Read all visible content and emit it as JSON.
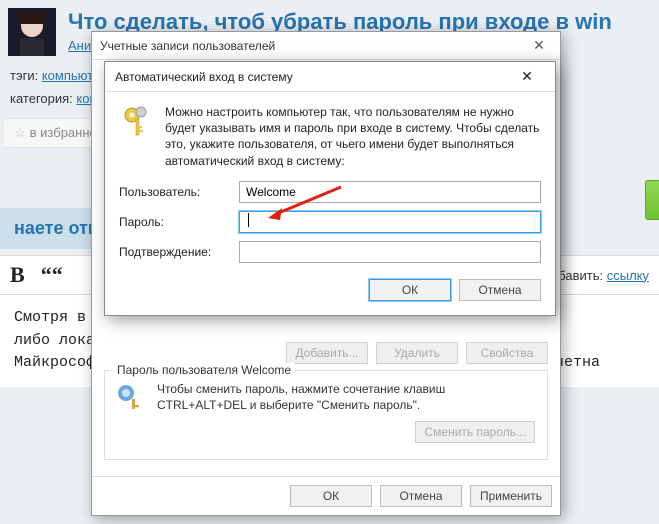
{
  "page": {
    "title": "Что сделать, чтоб убрать пароль при входе в win",
    "author_link": "Аникс [",
    "tags_label": "тэги:",
    "tags_link": "компьютер,",
    "category_label": "категория:",
    "category_link": "компь",
    "favorite": "в избранное",
    "answer_tab": "наете ответ",
    "add_label": "добавить:",
    "add_link": "ссылку",
    "answer_text": "Смотря в ка\nлибо локаль\nМайкрософт",
    "answer_suffix": "ановке? Учетна"
  },
  "parent_dialog": {
    "title": "Учетные записи пользователей",
    "add_btn": "Добавить...",
    "remove_btn": "Удалить",
    "props_btn": "Свойства",
    "group_legend": "Пароль пользователя Welcome",
    "group_help": "Чтобы сменить пароль, нажмите сочетание клавиш CTRL+ALT+DEL и выберите \"Сменить пароль\".",
    "change_pw_btn": "Сменить пароль...",
    "ok": "ОК",
    "cancel": "Отмена",
    "apply": "Применить"
  },
  "auto_dialog": {
    "title": "Автоматический вход в систему",
    "intro": "Можно настроить компьютер так, что пользователям не нужно будет указывать имя и пароль при входе в систему. Чтобы сделать это, укажите пользователя, от чьего имени будет выполняться автоматический вход в систему:",
    "user_label": "Пользователь:",
    "user_value": "Welcome",
    "password_label": "Пароль:",
    "confirm_label": "Подтверждение:",
    "ok": "ОК",
    "cancel": "Отмена"
  }
}
